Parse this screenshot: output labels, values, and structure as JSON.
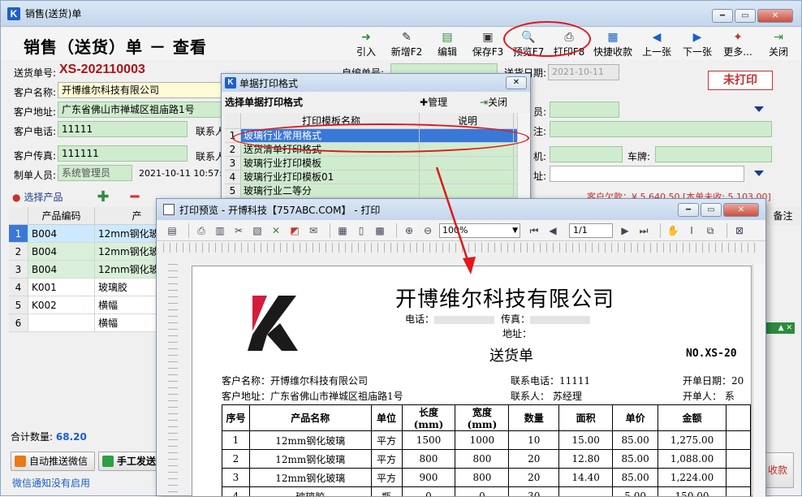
{
  "window": {
    "title": "销售(送货)单",
    "app_icon": "K"
  },
  "header": {
    "title": "销售（送货）单 － 查看"
  },
  "toolbar": [
    {
      "label": "引入",
      "icon": "import-icon"
    },
    {
      "label": "新增F2",
      "icon": "new-icon"
    },
    {
      "label": "编辑",
      "icon": "edit-icon"
    },
    {
      "label": "保存F3",
      "icon": "save-icon"
    },
    {
      "label": "预览F7",
      "icon": "preview-icon"
    },
    {
      "label": "打印F8",
      "icon": "print-icon"
    },
    {
      "label": "快捷收款",
      "icon": "payment-icon"
    },
    {
      "label": "上一张",
      "icon": "prev-icon"
    },
    {
      "label": "下一张",
      "icon": "next-icon"
    },
    {
      "label": "更多...",
      "icon": "more-icon"
    },
    {
      "label": "关闭",
      "icon": "close-icon"
    }
  ],
  "form": {
    "doc_no_label": "送货单号:",
    "doc_no": "XS-202110003",
    "self_no_label": "自编单号:",
    "delivery_date_label": "送货日期:",
    "delivery_date": "2021-10-11",
    "status": "未打印",
    "customer_name_label": "客户名称:",
    "customer_name": "开博维尔科技有限公司",
    "customer_addr_label": "客户地址:",
    "customer_addr": "广东省佛山市禅城区祖庙路1号",
    "customer_phone_label": "客户电话:",
    "customer_phone": "11111",
    "contact_label": "联系人",
    "customer_fax_label": "客户传真:",
    "customer_fax": "111111",
    "contact_label2": "联系人",
    "creator_label": "制单人员:",
    "creator": "系统管理员",
    "created_at": "2021-10-11 10:57:25",
    "staff_label": "员:",
    "note_label": "注:",
    "machine_label": "机:",
    "vehicle_label": "车牌:",
    "addr2_label": "址:",
    "debt_text": "客户欠款：¥ 5,640.50 [本单未收: 5,103.00]"
  },
  "product_grid": {
    "select_label": "选择产品",
    "columns": [
      "产品编码",
      "产"
    ],
    "rows": [
      {
        "n": "1",
        "code": "B004",
        "name": "12mm钢化玻璃"
      },
      {
        "n": "2",
        "code": "B004",
        "name": "12mm钢化玻璃"
      },
      {
        "n": "3",
        "code": "B004",
        "name": "12mm钢化玻璃"
      },
      {
        "n": "4",
        "code": "K001",
        "name": "玻璃胶"
      },
      {
        "n": "5",
        "code": "K002",
        "name": "横幅"
      },
      {
        "n": "6",
        "code": "",
        "name": "横幅"
      }
    ],
    "note_col": "备注",
    "total_label": "合计数量:",
    "total_value": "68.20"
  },
  "bottom": {
    "auto_wechat": "自动推送微信",
    "manual_send": "手工发送",
    "wechat_note": "微信通知没有启用",
    "collect": "收款"
  },
  "template_dialog": {
    "title": "单据打印格式",
    "heading": "选择单据打印格式",
    "manage": "管理",
    "close": "关闭",
    "columns": [
      "打印模板名称",
      "说明"
    ],
    "rows": [
      {
        "n": "1",
        "name": "玻璃行业常用格式",
        "desc": ""
      },
      {
        "n": "2",
        "name": "送货清单打印格式",
        "desc": ""
      },
      {
        "n": "3",
        "name": "玻璃行业打印模板",
        "desc": ""
      },
      {
        "n": "4",
        "name": "玻璃行业打印模板01",
        "desc": ""
      },
      {
        "n": "5",
        "name": "玻璃行业二等分",
        "desc": ""
      }
    ]
  },
  "preview": {
    "title": "打印预览 - 开博科技【757ABC.COM】 - 打印",
    "zoom": "100%",
    "page": "1/1",
    "company": "开博维尔科技有限公司",
    "phone_label": "电话：",
    "fax_label": "传真：",
    "address_label": "地址：",
    "doc_title": "送货单",
    "doc_no": "NO.XS-20",
    "cust_name": "客户名称：开博维尔科技有限公司",
    "cust_addr": "客户地址：广东省佛山市禅城区祖庙路1号",
    "contact_phone": "联系电话：11111",
    "contact_person": "联系人：   苏经理",
    "open_date": "开单日期：20",
    "open_person": "开单人：   系",
    "table_headers": [
      "序号",
      "产品名称",
      "单位",
      "长度(mm)",
      "宽度(mm)",
      "数量",
      "面积",
      "单价",
      "金额"
    ],
    "table_rows": [
      [
        "1",
        "12mm钢化玻璃",
        "平方",
        "1500",
        "1000",
        "10",
        "15.00",
        "85.00",
        "1,275.00"
      ],
      [
        "2",
        "12mm钢化玻璃",
        "平方",
        "800",
        "800",
        "20",
        "12.80",
        "85.00",
        "1,088.00"
      ],
      [
        "3",
        "12mm钢化玻璃",
        "平方",
        "900",
        "800",
        "20",
        "14.40",
        "85.00",
        "1,224.00"
      ],
      [
        "4",
        "玻璃胶",
        "瓶",
        "0",
        "0",
        "30",
        "",
        "5.00",
        "150.00"
      ]
    ]
  },
  "colors": {
    "accent": "#1d5fc8",
    "doc_no": "#a8141a",
    "highlight_ring": "#e01818",
    "grid_green": "#cfeccf"
  }
}
